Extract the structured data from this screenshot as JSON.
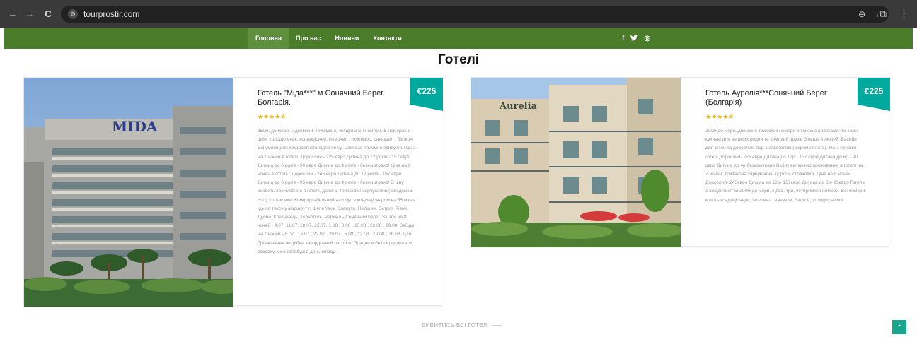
{
  "browser": {
    "back": "←",
    "forward": "→",
    "reload": "C",
    "url": "tourprostir.com",
    "zoom_icon": "⊖",
    "star_icon": "☆",
    "extensions_icon": "⧉",
    "menu_icon": "⋮"
  },
  "nav": {
    "items": [
      "Головна",
      "Про нас",
      "Новини",
      "Контакти"
    ],
    "active_index": 0,
    "social": [
      "f",
      "🐦",
      "◎"
    ]
  },
  "page": {
    "title": "Готелі",
    "see_all": "ДИВИТИСЬ ВСІ ГОТЕЛІ",
    "scroll_top": "⌃"
  },
  "hotels": [
    {
      "name": "Готель \"Міда***\" м.Сонячний Берег. Болгарія.",
      "price": "€225",
      "rating_stars": "★★★★⯪",
      "image_sign": "MIDA",
      "description": "350м. до моря, с двомісні, трикімісні, чотиримісні номери. В номерах є фен, холодильник, кондиціонер, інтернет , телевізор, санвузол , балкон. Всі умови для комфортного відпочинку. Ціни вас приємно здивують! Ціна на 7 ночей в готелі: Дорослий - 225 євро Дитина до 12 років - 157 євро Дитина до 6 років - 90 євро Дитина до 4 років - безкоштовно! Ціна на 8 ночей в готелі : Дорослий - 245 євро Дитина до 12 років - 167 євро Дитина до 6 років - 95 євро Дитина до 4 років - безкоштовно! В ціну входить проживання в готелі, дорога, тризазове харчування (шведський стіл), страховка. Комфортабельний автобус з кондиціонером на 55 місць Їде по такому маршруту: Шепетівка, Славута, Нетішин, Острог, Рівне, Дубно, Кременець, Тернопіль, Черкаці - Сонячний берег. Заїзди на 8 ночей - 4.07, 11.07, 18.07, 25.07, 1.08 , 8.08 , 15.08 , 22.08 , 29.08. Заїзди на 7 ночей - 8.07 , 15.07 , 22.07 , 29.07 , 5.08 , 12.08 , 19.08 , 26.08. Для бронювання потрібен закордонний паспорт. Працюєм без передоплати, розрахунок в автобусі в день виїзду."
    },
    {
      "name": "Готель Аурелія***Сонячний Берег (Болгарія)",
      "price": "€225",
      "rating_stars": "★★★★⯪",
      "image_sign": "Aurelia",
      "description": "200м до моря, двомісні, трикмісні номери а також є апартаменти з міні кухнею для великих родин та компанії друзів більше 4 людей. Басейн для дітей та дорослих, бар з алкоголем ( окрема плата). На 7 ночей в готелі Дорослий- 225 євро Дитина до 12р - 157 євро Дитина до 6р - 90 євро Дитина до 4р безкоштовно В ціну включено проживання в готелі на 7 ночей, тризазове харчування, дорога, страховка. Ціна на 8 ночей Дорослий- 245євро Дитина до 12р- 167євро Дитина до 6р- 95євро Готель знаходиться за 200м до моря, є дво, три, чотиримісні номери. Всі номери мають кондиціонери, інтернет, санвузли, балкон, холодильники."
    }
  ],
  "colors": {
    "nav_bg": "#4a7c2a",
    "badge": "#00a99d",
    "stars": "#f0b400"
  }
}
